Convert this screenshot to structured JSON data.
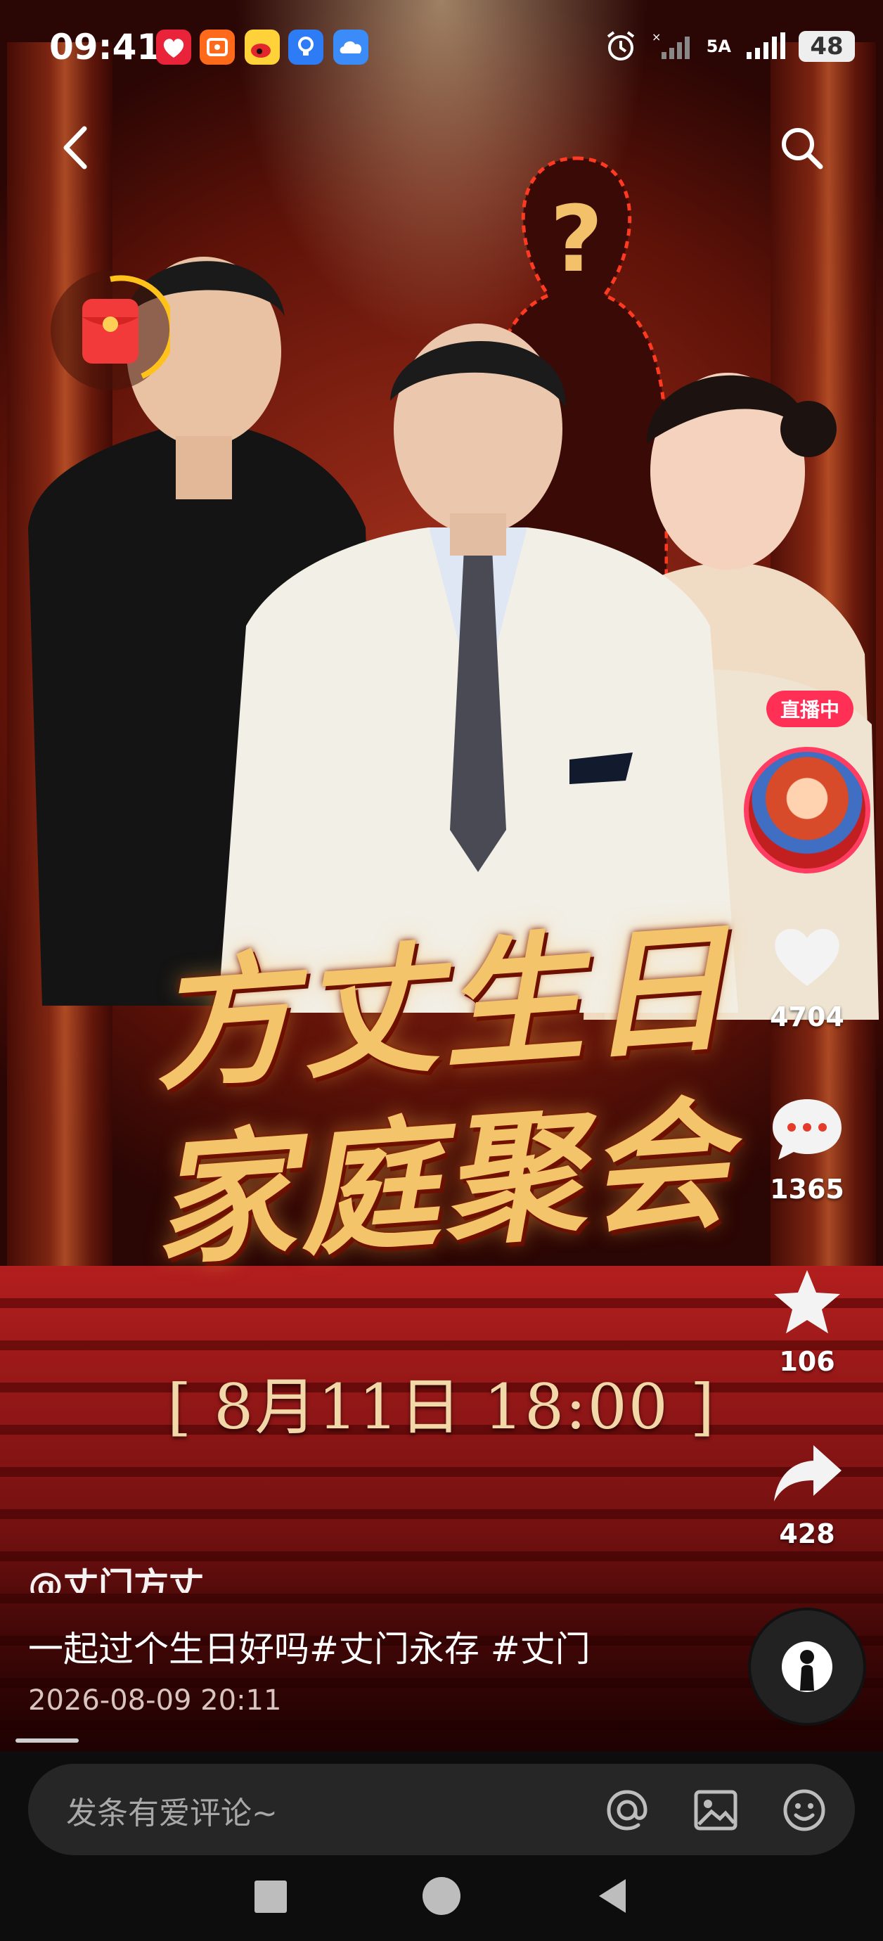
{
  "status_bar": {
    "time": "09:41",
    "signal_label": "5A",
    "battery": "48",
    "app_icons": [
      "lovers-heart-icon",
      "video-app-icon",
      "weibo-icon",
      "idea-bulb-icon",
      "cloud-icon"
    ]
  },
  "poster": {
    "title_line1": "方丈生日",
    "title_line2": "家庭聚会",
    "date_text": "[ 8月11日  18:00 ]"
  },
  "live": {
    "badge": "直播中"
  },
  "actions": {
    "likes": "4704",
    "comments": "1365",
    "favorites": "106",
    "shares": "428"
  },
  "post": {
    "author": "@丈门方丈",
    "caption": "一起过个生日好吗#丈门永存 #丈门",
    "datetime": "2026-08-09 20:11"
  },
  "comment_bar": {
    "placeholder": "发条有爱评论~"
  },
  "colors": {
    "live_red": "#ff2f56",
    "poster_gold": "#f4c46a",
    "background": "#0d0d0d"
  }
}
